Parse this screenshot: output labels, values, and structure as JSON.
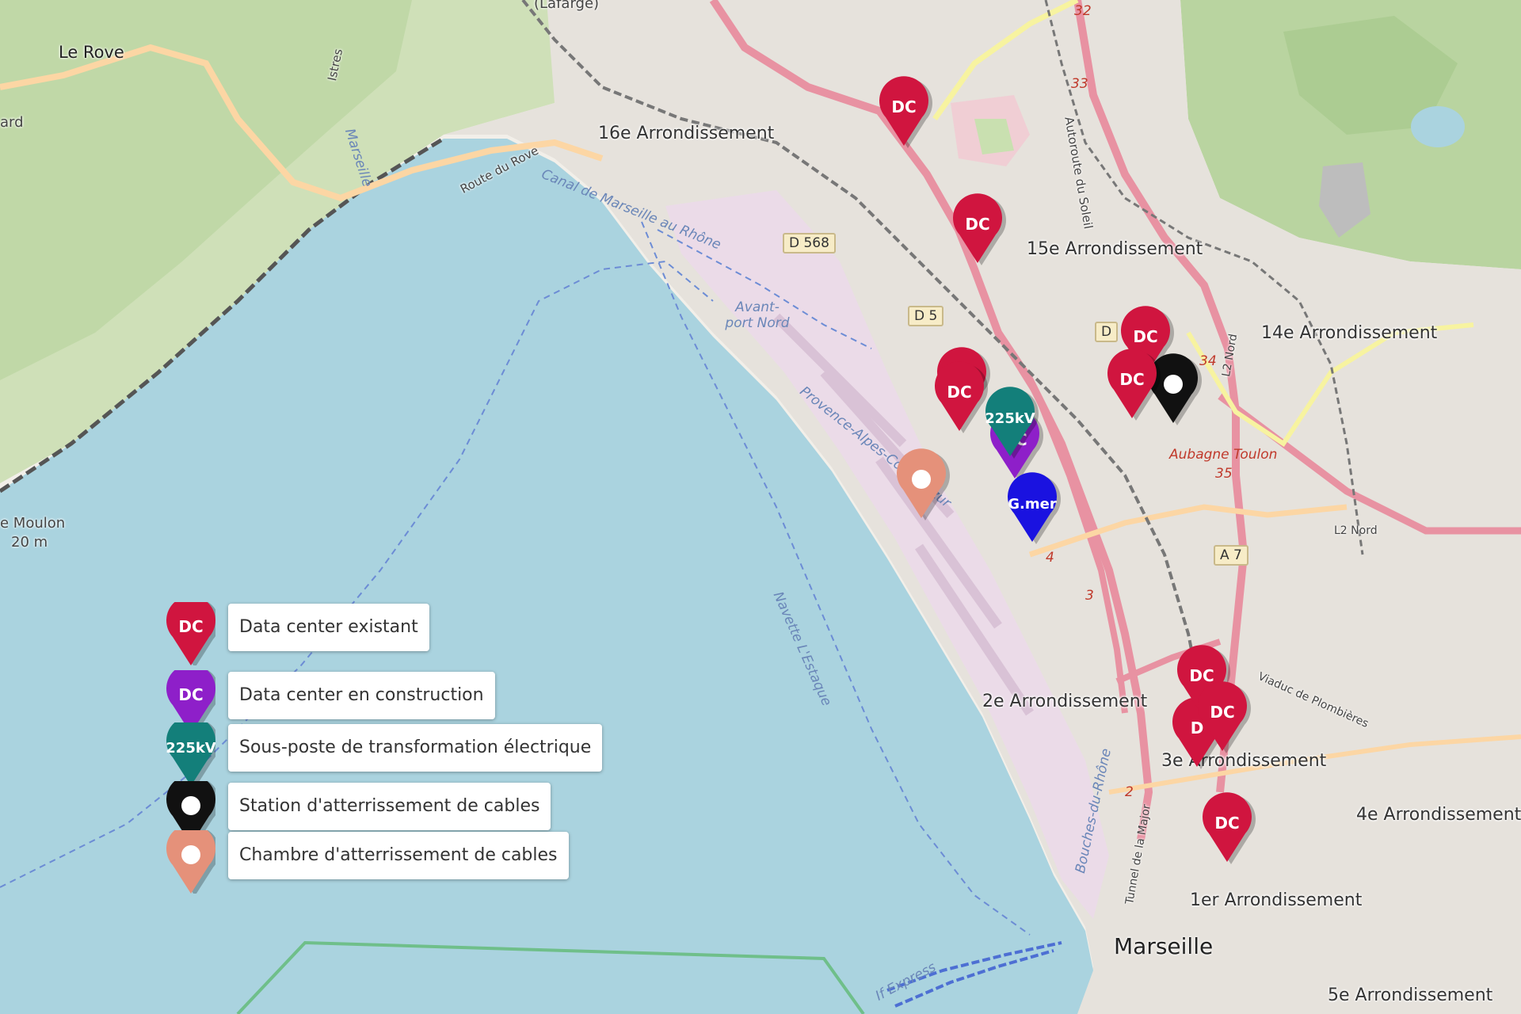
{
  "map": {
    "place_labels": [
      {
        "id": "le-rove",
        "text": "Le Rove"
      },
      {
        "id": "arr16",
        "text": "16e Arrondissement"
      },
      {
        "id": "arr15",
        "text": "15e Arrondissement"
      },
      {
        "id": "arr14",
        "text": "14e Arrondissement"
      },
      {
        "id": "arr2",
        "text": "2e Arrondissement"
      },
      {
        "id": "arr3",
        "text": "3e Arrondissement"
      },
      {
        "id": "arr4",
        "text": "4e Arrondissement"
      },
      {
        "id": "arr1",
        "text": "1er Arrondissement"
      },
      {
        "id": "arr5",
        "text": "5e Arrondissement"
      },
      {
        "id": "marseille",
        "text": "Marseille"
      },
      {
        "id": "moulon",
        "text": "e Moulon"
      },
      {
        "id": "moulon-alt",
        "text": "20 m"
      },
      {
        "id": "ard",
        "text": "ard"
      },
      {
        "id": "lafarge",
        "text": "(Lafarge)"
      }
    ],
    "water_labels": [
      {
        "id": "canal",
        "text": "Canal de Marseille au Rhône"
      },
      {
        "id": "avant-port",
        "text": "Avant-port Nord"
      },
      {
        "id": "navette",
        "text": "Navette L'Estaque"
      },
      {
        "id": "provence",
        "text": "Provence-Alpes-Côte d'Azur"
      },
      {
        "id": "bouches",
        "text": "Bouches-du-Rhône"
      },
      {
        "id": "express",
        "text": "If Express"
      }
    ],
    "road_labels": [
      {
        "id": "route-rove",
        "text": "Route du Rove"
      },
      {
        "id": "istres",
        "text": "Istres"
      },
      {
        "id": "marseille-road",
        "text": "Marseille"
      },
      {
        "id": "autoroute-soleil",
        "text": "Autoroute du Soleil"
      },
      {
        "id": "aubagne-toulon",
        "text": "Aubagne Toulon"
      },
      {
        "id": "viaduc",
        "text": "Viaduc de Plombières"
      },
      {
        "id": "l2nord-1",
        "text": "L2 Nord"
      },
      {
        "id": "l2nord-2",
        "text": "L2 Nord"
      },
      {
        "id": "tunnel-major",
        "text": "Tunnel de la Major"
      }
    ],
    "road_shields": [
      {
        "id": "d568",
        "text": "D 568"
      },
      {
        "id": "d5",
        "text": "D 5"
      },
      {
        "id": "d-partial",
        "text": "D"
      },
      {
        "id": "a7",
        "text": "A 7"
      }
    ],
    "road_numbers": [
      "32",
      "33",
      "34",
      "35",
      "3",
      "4",
      "2"
    ]
  },
  "markers": [
    {
      "type": "dc-existing",
      "label": "DC"
    },
    {
      "type": "dc-existing",
      "label": "DC"
    },
    {
      "type": "dc-existing",
      "label": "DC"
    },
    {
      "type": "dc-existing",
      "label": "DC"
    },
    {
      "type": "cable-station",
      "label": ""
    },
    {
      "type": "dc-existing",
      "label": "DC"
    },
    {
      "type": "dc-existing",
      "label": "DC"
    },
    {
      "type": "dc-construction",
      "label": "DC"
    },
    {
      "type": "substation",
      "label": "225kV"
    },
    {
      "type": "cable-chamber",
      "label": ""
    },
    {
      "type": "special",
      "label": "G.mer"
    },
    {
      "type": "dc-existing",
      "label": "D"
    },
    {
      "type": "dc-existing",
      "label": "DC"
    },
    {
      "type": "dc-existing",
      "label": "DC"
    },
    {
      "type": "dc-existing",
      "label": "DC"
    }
  ],
  "legend": {
    "items": [
      {
        "icon_label": "DC",
        "text": "Data center existant",
        "color": "#d0153f",
        "shape": "pin"
      },
      {
        "icon_label": "DC",
        "text": "Data center en construction",
        "color": "#8e1fc9",
        "shape": "pin"
      },
      {
        "icon_label": "225kV",
        "text": "Sous-poste de transformation électrique",
        "color": "#137f7a",
        "shape": "pin"
      },
      {
        "icon_label": "",
        "text": "Station d'atterrissement de cables",
        "color": "#111111",
        "shape": "ring"
      },
      {
        "icon_label": "",
        "text": "Chambre d'atterrissement de cables",
        "color": "#e5917a",
        "shape": "ring"
      }
    ]
  },
  "colors": {
    "sea": "#aad3df",
    "land": "#f2efe9",
    "wood": "#add19e",
    "industrial": "#ebdbe8",
    "motorway": "#e892a2",
    "primary": "#fcd6a4",
    "dc_existing": "#d0153f",
    "dc_construction": "#8e1fc9",
    "substation": "#137f7a",
    "cable_station": "#111111",
    "cable_chamber": "#e5917a",
    "special": "#1a12e0"
  }
}
